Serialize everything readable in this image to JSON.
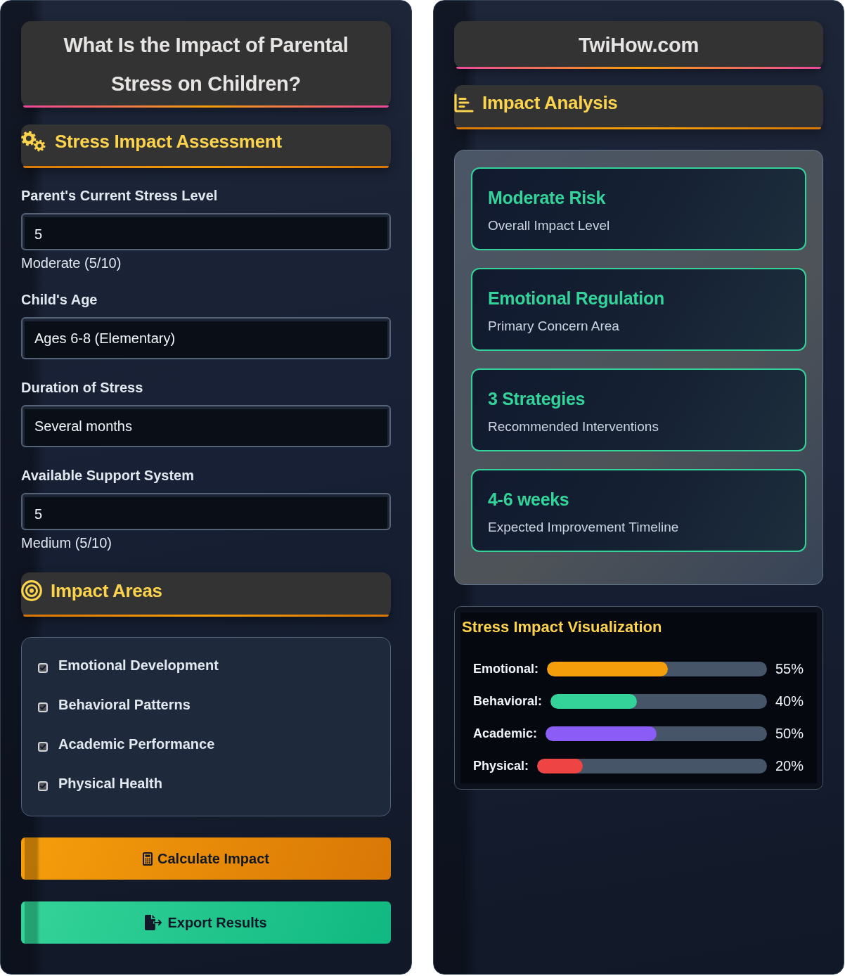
{
  "left_panel": {
    "title": "What Is the Impact of Parental Stress on Children?",
    "assessment": {
      "heading": "Stress Impact Assessment",
      "fields": [
        {
          "kind": "number",
          "label": "Parent's Current Stress Level",
          "value": "5",
          "note": "Moderate (5/10)"
        },
        {
          "kind": "select",
          "label": "Child's Age",
          "value": "Ages 6-8 (Elementary)"
        },
        {
          "kind": "select",
          "label": "Duration of Stress",
          "value": "Several months"
        },
        {
          "kind": "number",
          "label": "Available Support System",
          "value": "5",
          "note": "Medium (5/10)"
        }
      ]
    },
    "impact_areas": {
      "heading": "Impact Areas",
      "items": [
        {
          "label": "Emotional Development",
          "checked": true
        },
        {
          "label": "Behavioral Patterns",
          "checked": true
        },
        {
          "label": "Academic Performance",
          "checked": true
        },
        {
          "label": "Physical Health",
          "checked": true
        }
      ]
    },
    "buttons": [
      {
        "kind": "calculate",
        "label": "Calculate Impact"
      },
      {
        "kind": "export",
        "label": "Export Results"
      }
    ]
  },
  "right_panel": {
    "site_title": "TwiHow.com",
    "analysis": {
      "heading": "Impact Analysis",
      "results": [
        {
          "value": "Moderate Risk",
          "caption": "Overall Impact Level"
        },
        {
          "value": "Emotional Regulation",
          "caption": "Primary Concern Area"
        },
        {
          "value": "3 Strategies",
          "caption": "Recommended Interventions"
        },
        {
          "value": "4-6 weeks",
          "caption": "Expected Improvement Timeline"
        }
      ]
    },
    "visualization": {
      "title": "Stress Impact Visualization",
      "bars": [
        {
          "label": "Emotional:",
          "level": 0.55,
          "reading": "55%",
          "color": "#f59e0b"
        },
        {
          "label": "Behavioral:",
          "level": 0.4,
          "reading": "40%",
          "color": "#34d399"
        },
        {
          "label": "Academic:",
          "level": 0.5,
          "reading": "50%",
          "color": "#8b5cf6"
        },
        {
          "label": "Physical:",
          "level": 0.2,
          "reading": "20%",
          "color": "#ef4444"
        }
      ]
    }
  }
}
